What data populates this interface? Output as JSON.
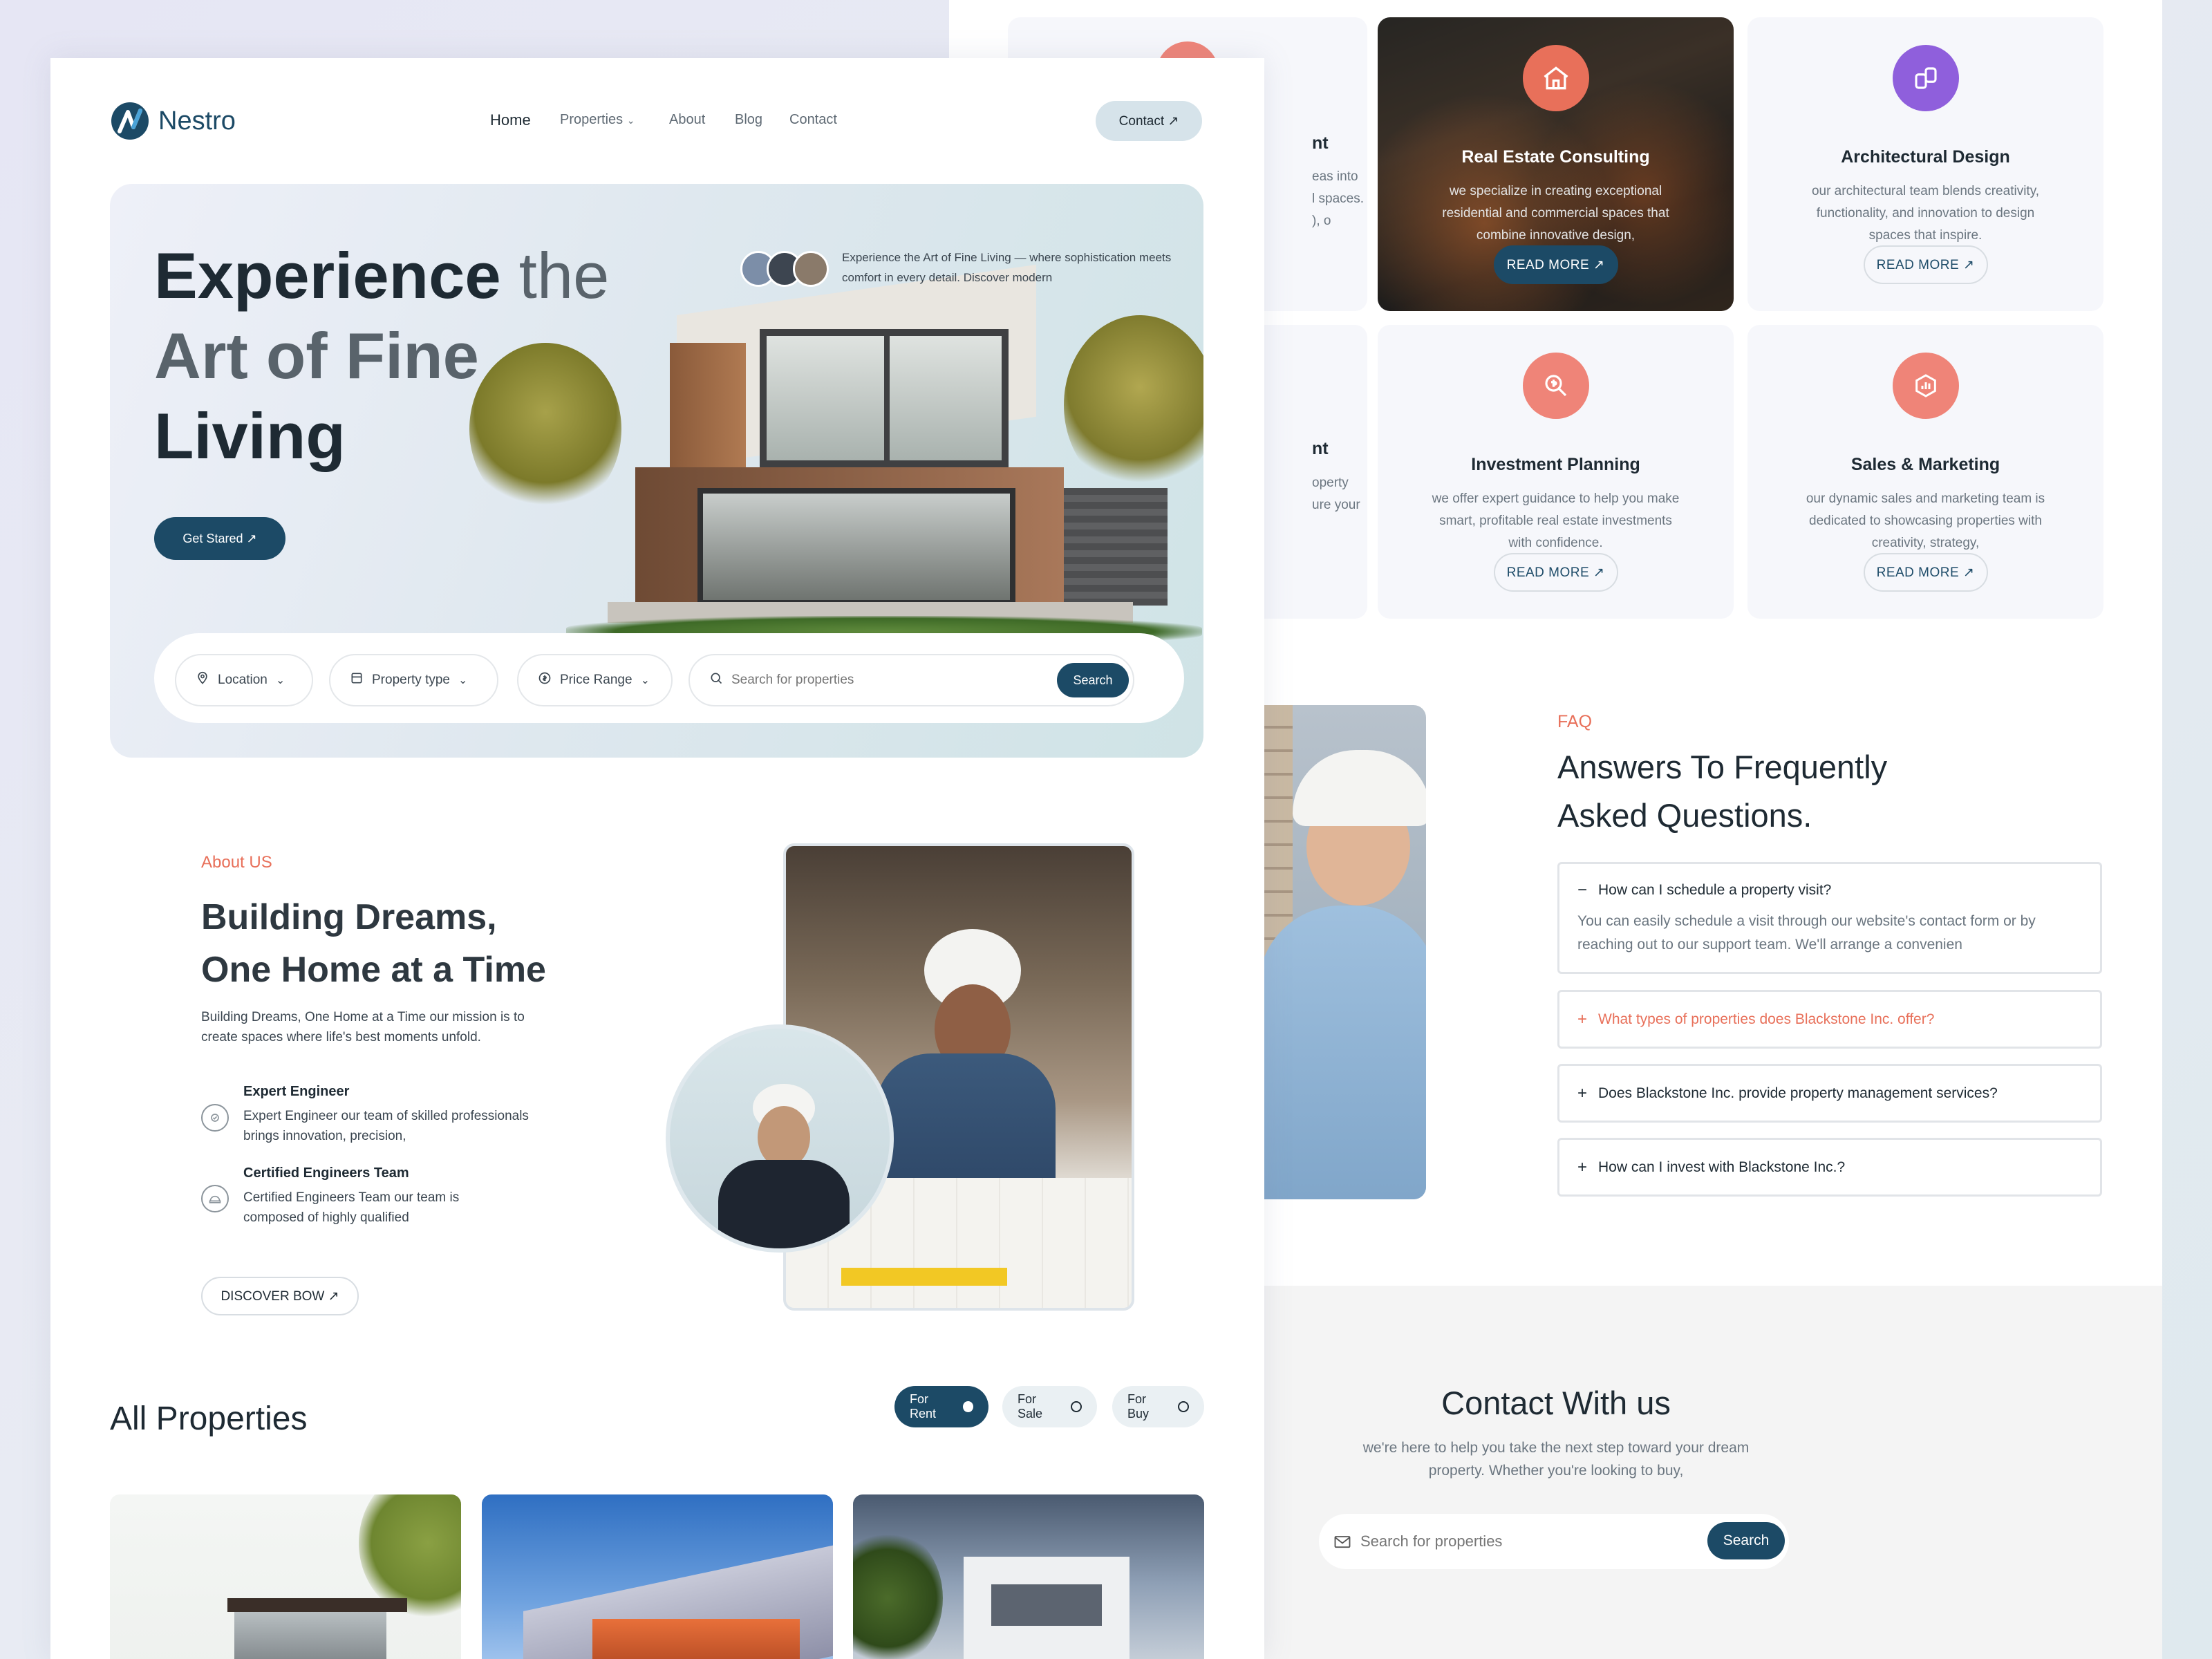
{
  "brand": {
    "name": "Nestro",
    "colors": {
      "primary": "#1c4a66",
      "accent": "#e8705a"
    }
  },
  "nav": {
    "links": [
      "Home",
      "Properties",
      "About",
      "Blog",
      "Contact"
    ],
    "contact_button": "Contact ↗"
  },
  "hero": {
    "title_line1_dark": "Experience",
    "title_line1_light": "the",
    "title_line2": "Art of Fine",
    "title_line3": "Living",
    "tagline": "Experience the Art of Fine Living — where sophistication meets comfort in every detail. Discover modern",
    "cta": "Get Stared ↗",
    "search": {
      "location": "Location",
      "property_type": "Property type",
      "price_range": "Price Range",
      "placeholder": "Search for properties",
      "button": "Search"
    }
  },
  "about": {
    "eyebrow": "About US",
    "title_line1": "Building Dreams,",
    "title_line2": "One Home at a Time",
    "body": "Building Dreams, One Home at a Time  our mission is to create spaces where life's best moments unfold.",
    "features": [
      {
        "title": "Expert Engineer",
        "text": "Expert Engineer our team of skilled professionals brings innovation, precision,",
        "icon": "badge-icon"
      },
      {
        "title": "Certified Engineers Team",
        "text": "Certified Engineers Team our team is composed of highly qualified",
        "icon": "helmet-icon"
      }
    ],
    "button": "DISCOVER BOW ↗"
  },
  "properties": {
    "title": "All Properties",
    "tabs": [
      "For Rent",
      "For Sale",
      "For Buy"
    ],
    "active_tab": "For Rent"
  },
  "services": [
    {
      "title": "Real Estate Consulting",
      "text": "we specialize in creating exceptional residential and commercial spaces that combine innovative design,",
      "button": "READ MORE ↗",
      "icon": "house-icon",
      "color": "#e8705a"
    },
    {
      "title": "Architectural Design",
      "text": "our architectural team blends creativity, functionality, and innovation to design spaces that inspire.",
      "button": "READ MORE ↗",
      "icon": "design-icon",
      "color": "#8f5fdc"
    },
    {
      "title": "Investment Planning",
      "text": "we offer expert guidance to help you make smart, profitable real estate investments with confidence.",
      "button": "READ MORE ↗",
      "icon": "dollar-icon",
      "color": "#ef8478"
    },
    {
      "title": "Sales & Marketing",
      "text": "our dynamic sales and marketing team is dedicated to showcasing properties with creativity, strategy,",
      "button": "READ MORE ↗",
      "icon": "chart-icon",
      "color": "#ef8478"
    }
  ],
  "partial_cards": {
    "top_title": "nt",
    "top_text": [
      "eas into",
      "l spaces.",
      "), o"
    ],
    "bottom_title": "nt",
    "bottom_text": [
      "operty",
      "ure your"
    ]
  },
  "faq": {
    "eyebrow": "FAQ",
    "title_line1": "Answers To Frequently",
    "title_line2": "Asked Questions.",
    "items": [
      {
        "q": "How can I schedule a property visit?",
        "a": "You can easily schedule a visit through our website's contact form or by reaching out to our support team. We'll arrange a convenien",
        "open": "−"
      },
      {
        "q": "What types of properties does Blackstone Inc. offer?",
        "open": "+"
      },
      {
        "q": "Does Blackstone Inc. provide property management services?",
        "open": "+"
      },
      {
        "q": "How can I invest with Blackstone Inc.?",
        "open": "+"
      }
    ]
  },
  "contact": {
    "title": "Contact With us",
    "text": "we're here to help you take the next step toward your dream property. Whether you're looking to buy,",
    "placeholder": "Search for properties",
    "button": "Search"
  }
}
